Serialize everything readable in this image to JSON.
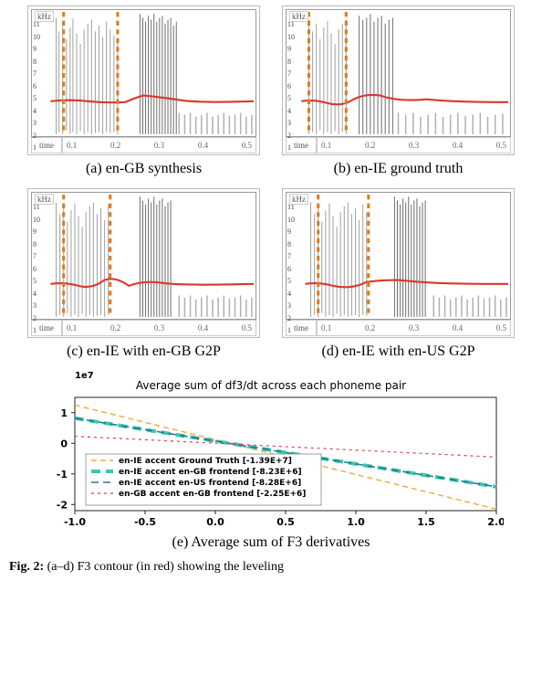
{
  "spectrograms": {
    "yaxis_unit": "kHz",
    "xaxis_label": "time",
    "xticks": [
      "0.1",
      "0.2",
      "0.3",
      "0.4",
      "0.5"
    ],
    "yticks": [
      "1",
      "2",
      "3",
      "4",
      "5",
      "6",
      "7",
      "8",
      "9",
      "10",
      "11"
    ],
    "panels": [
      {
        "id": "a",
        "caption": "(a) en-GB synthesis"
      },
      {
        "id": "b",
        "caption": "(b) en-IE ground truth"
      },
      {
        "id": "c",
        "caption": "(c) en-IE with en-GB G2P"
      },
      {
        "id": "d",
        "caption": "(d) en-IE with en-US G2P"
      }
    ]
  },
  "chart_data": {
    "type": "line",
    "title": "Average sum of df3/dt across each phoneme pair",
    "exponent_label": "1e7",
    "xlabel": "",
    "ylabel": "",
    "xlim": [
      -1.0,
      2.0
    ],
    "ylim": [
      -2.2,
      1.5
    ],
    "xticks": [
      -1.0,
      -0.5,
      0.0,
      0.5,
      1.0,
      1.5,
      2.0
    ],
    "yticks": [
      -2,
      -1,
      0,
      1
    ],
    "series": [
      {
        "name": "en-IE accent Ground Truth [-1.39E+7]",
        "color": "#f2a93b",
        "style": "dashed-thin",
        "x": [
          -1.0,
          2.0
        ],
        "y": [
          1.25,
          -2.15
        ]
      },
      {
        "name": "en-IE accent en-GB frontend [-8.23E+6]",
        "color": "#3fc4b2",
        "style": "dash-thick",
        "x": [
          -1.0,
          2.0
        ],
        "y": [
          0.82,
          -1.42
        ]
      },
      {
        "name": "en-IE accent en-US frontend [-8.28E+6]",
        "color": "#1f7a8c",
        "style": "dashed-med",
        "x": [
          -1.0,
          2.0
        ],
        "y": [
          0.82,
          -1.42
        ]
      },
      {
        "name": "en-GB accent en-GB frontend [-2.25E+6]",
        "color": "#d6455a",
        "style": "dotted-thin",
        "x": [
          -1.0,
          2.0
        ],
        "y": [
          0.23,
          -0.45
        ]
      }
    ],
    "caption": "(e) Average sum of F3 derivatives"
  },
  "figure_caption_prefix": "Fig. 2: ",
  "figure_caption_body": "(a–d) F3 contour (in red) showing the leveling"
}
